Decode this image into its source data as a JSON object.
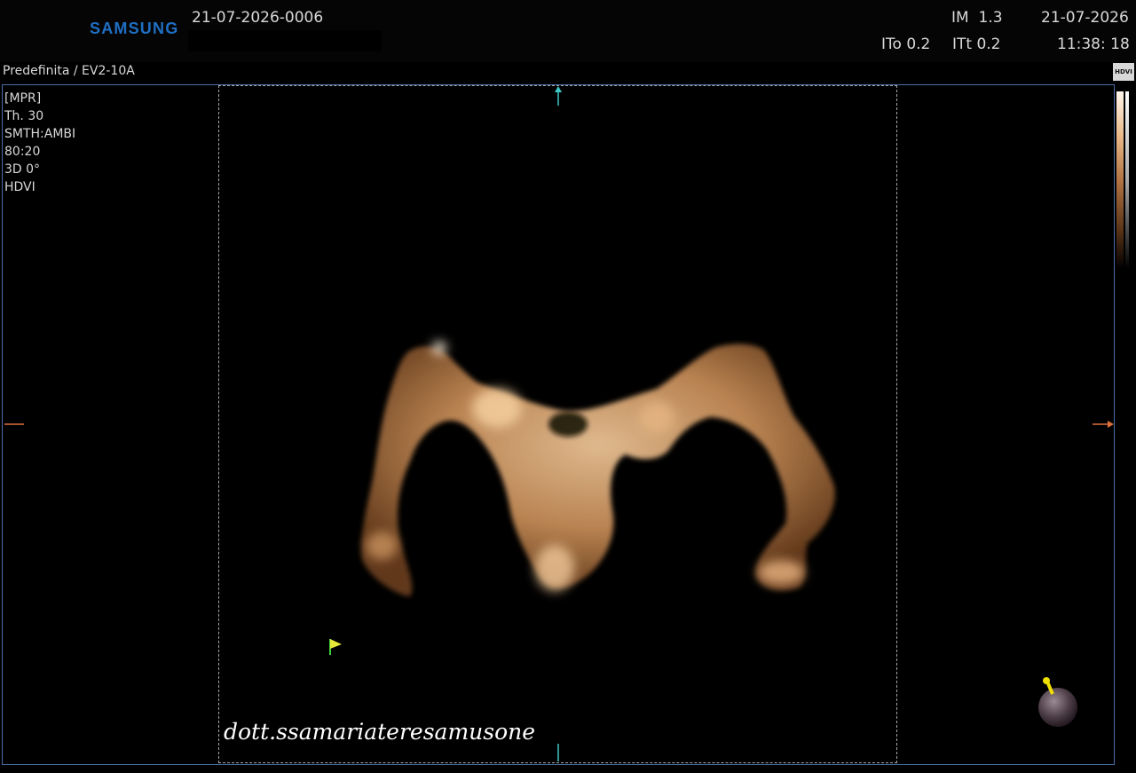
{
  "header": {
    "brand": "SAMSUNG",
    "study_id": "21-07-2026-0006",
    "im_label": "IM",
    "im_value": "1.3",
    "ito": "ITo 0.2",
    "itt": "ITt 0.2",
    "date": "21-07-2026",
    "time": "11:38: 18"
  },
  "preset": "Predefinita / EV2-10A",
  "hdvi_badge": "HDVI",
  "params": [
    "[MPR]",
    "Th. 30",
    "SMTH:AMBI",
    "80:20",
    "3D 0°",
    "HDVI"
  ],
  "watermark": "dott.ssamariateresamusone",
  "colors": {
    "brand_blue": "#1f6fc4",
    "frame_blue": "#4a6fa5",
    "marker_cyan": "#3fc8c8",
    "marker_orange": "#e0703a",
    "tissue": "#d6a06a",
    "flag_yellow": "#e8e83a",
    "flag_green": "#3acc3a"
  },
  "icons": {
    "top_marker": "arrow-up-icon",
    "left_marker": "dash-icon",
    "right_marker": "arrow-right-icon",
    "bottom_marker": "tick-icon",
    "orientation_flag": "flag-icon",
    "orientation_ball": "orientation-ball-icon"
  }
}
